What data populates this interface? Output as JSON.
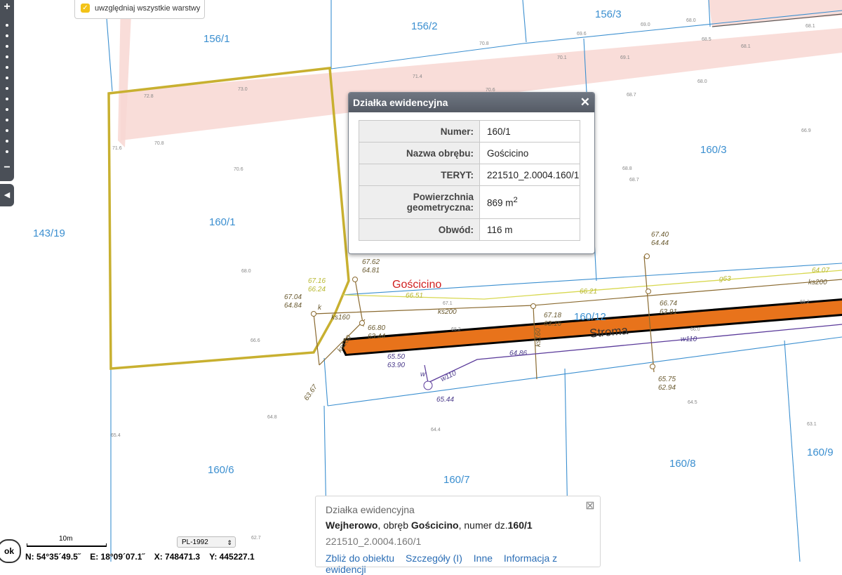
{
  "layers_toggle": {
    "label": "uwzględniaj wszystkie warstwy",
    "checked": true
  },
  "map": {
    "parcels": [
      {
        "id": "156/1",
        "label": "156/1"
      },
      {
        "id": "156/2",
        "label": "156/2"
      },
      {
        "id": "156/3",
        "label": "156/3"
      },
      {
        "id": "143/19",
        "label": "143/19"
      },
      {
        "id": "160/1",
        "label": "160/1"
      },
      {
        "id": "160/3",
        "label": "160/3"
      },
      {
        "id": "160/12",
        "label": "160/12"
      },
      {
        "id": "160/6",
        "label": "160/6"
      },
      {
        "id": "160/7",
        "label": "160/7"
      },
      {
        "id": "160/8",
        "label": "160/8"
      },
      {
        "id": "160/9",
        "label": "160/9"
      }
    ],
    "place_name": "Gościcino",
    "street_name": "Stroma",
    "spot_heights": [
      "68.0",
      "68.1",
      "69.0",
      "68.5",
      "68.1",
      "69.6",
      "70.8",
      "70.1",
      "69.1",
      "68.0",
      "71.4",
      "70.6",
      "68.7",
      "72.8",
      "73.0",
      "71.6",
      "70.8",
      "70.6",
      "66.9",
      "68.8",
      "68.7",
      "68.0",
      "67.1",
      "66.6",
      "68.2",
      "69.2",
      "66.0",
      "64.8",
      "64.4",
      "64.5",
      "63.1",
      "65.4",
      "62.7"
    ],
    "utility_labels": [
      "67.16",
      "66.24",
      "67.04",
      "64.84",
      "67.62",
      "64.81",
      "66.80",
      "63.44",
      "67.18",
      "63.16",
      "67.40",
      "64.44",
      "66.74",
      "63.91",
      "65.75",
      "62.94",
      "65.50",
      "63.90",
      "65.44",
      "63.67",
      "64.07",
      "66.21",
      "66.51",
      "64.86",
      "ks160",
      "ks200",
      "ks200",
      "ks160",
      "ks160",
      "w110",
      "w110",
      "g63",
      "k",
      "w"
    ]
  },
  "popup": {
    "title": "Działka ewidencyjna",
    "rows": [
      {
        "key": "Numer:",
        "value": "160/1"
      },
      {
        "key": "Nazwa obrębu:",
        "value": "Gościcino"
      },
      {
        "key": "TERYT:",
        "value": "221510_2.0004.160/1"
      },
      {
        "key": "Powierzchnia geometryczna:",
        "value": "869 m",
        "sup": "2"
      },
      {
        "key": "Obwód:",
        "value": "116 m"
      }
    ]
  },
  "info_panel": {
    "title": "Działka ewidencyjna",
    "city": "Wejherowo",
    "district_prefix": ", obręb ",
    "district": "Gościcino",
    "number_prefix": ", numer dz.",
    "number": "160/1",
    "teryt": "221510_2.0004.160/1",
    "links": [
      "Zbliż do obiektu",
      "Szczegóły (I)",
      "Inne",
      "Informacja z ewidencji"
    ]
  },
  "status": {
    "ok_label": "ok",
    "scale_label": "10m",
    "crs": "PL-1992",
    "coords": {
      "n": "N: 54°35´49.5˝",
      "e": "E: 18°09´07.1˝",
      "x": "X: 748471.3",
      "y": "Y: 445227.1"
    }
  },
  "colors": {
    "road": "#e8731b",
    "selected_parcel": "#c8b030",
    "parcel_line": "#3b8fd0",
    "popup_header": "#5d636d",
    "link": "#2a6db5"
  }
}
